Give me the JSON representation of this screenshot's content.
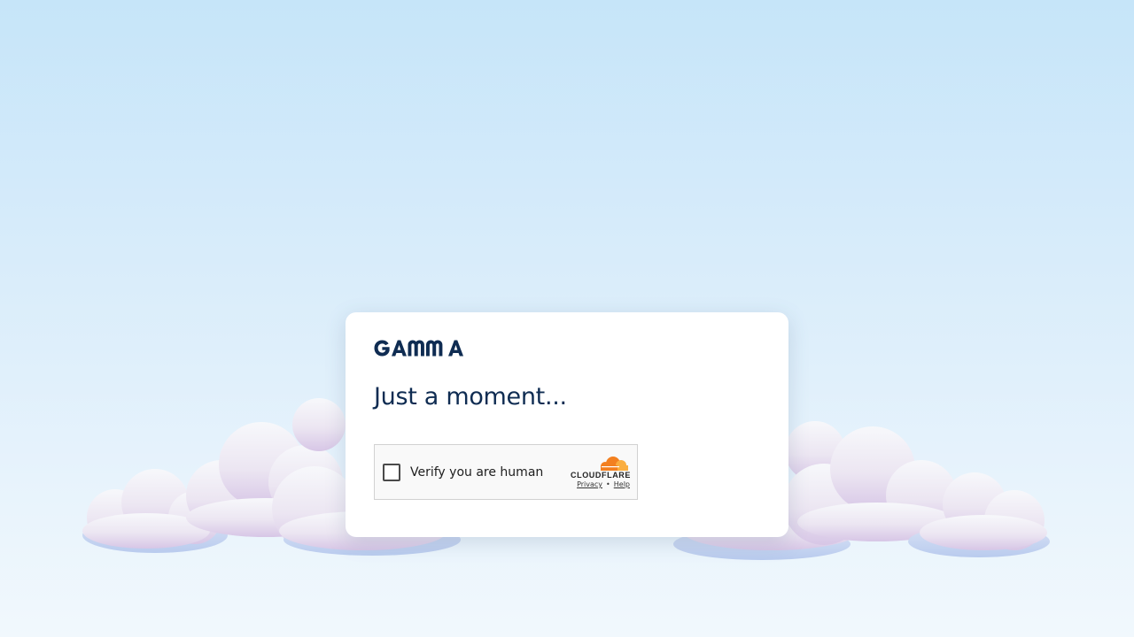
{
  "brand": {
    "name": "GAMMA",
    "text_color": "#0f2c52"
  },
  "page": {
    "heading": "Just a moment..."
  },
  "challenge": {
    "checkbox_label": "Verify you are human",
    "provider": "CLOUDFLARE",
    "privacy_link": "Privacy",
    "separator": "•",
    "help_link": "Help",
    "provider_color": "#f38020"
  },
  "background": {
    "sky_top": "#c6e5f9",
    "sky_bottom": "#f1f8fd",
    "decoration": "cloud-illustration"
  }
}
